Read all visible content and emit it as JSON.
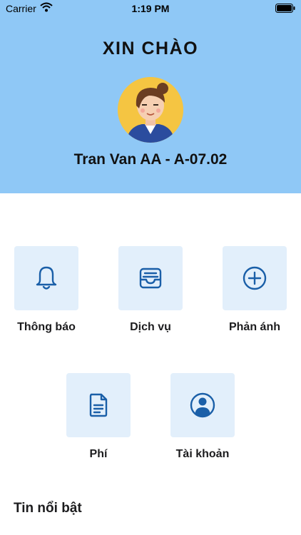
{
  "status_bar": {
    "carrier": "Carrier",
    "time": "1:19 PM"
  },
  "header": {
    "greeting": "XIN CHÀO",
    "user_line": "Tran Van AA - A-07.02"
  },
  "menu": [
    {
      "label": "Thông báo",
      "icon": "bell-icon"
    },
    {
      "label": "Dịch vụ",
      "icon": "inbox-icon"
    },
    {
      "label": "Phản ánh",
      "icon": "plus-circle-icon"
    },
    {
      "label": "Phí",
      "icon": "document-icon"
    },
    {
      "label": "Tài khoản",
      "icon": "user-circle-icon"
    }
  ],
  "highlights": {
    "title": "Tin nổi bật"
  },
  "colors": {
    "header_bg": "#8fc8f6",
    "tile_bg": "#e2effb",
    "icon": "#1a5fa8"
  }
}
